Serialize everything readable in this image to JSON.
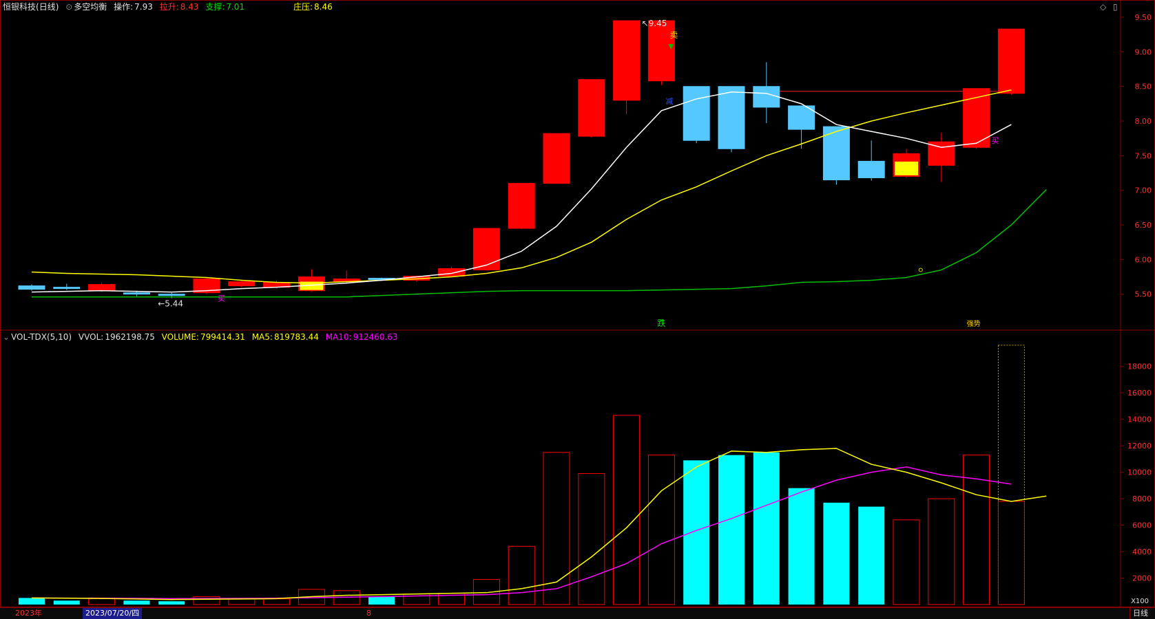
{
  "price_header": {
    "stock": "恒银科技",
    "period": "(日线)",
    "indicator": "多空均衡",
    "op_label": "操作:",
    "op_value": "7.93",
    "lift_label": "拉升:",
    "lift_value": "8.43",
    "support_label": "支撑:",
    "support_value": "7.01",
    "press_label": "庄压:",
    "press_value": "8.46"
  },
  "vol_header": {
    "name": "VOL-TDX(5,10)",
    "vvol_label": "VVOL:",
    "vvol_value": "1962198.75",
    "volume_label": "VOLUME:",
    "volume_value": "799414.31",
    "ma5_label": "MA5:",
    "ma5_value": "819783.44",
    "ma10_label": "MA10:",
    "ma10_value": "912460.63"
  },
  "annotations": {
    "high": "9.45",
    "low": "5.44",
    "sell": "卖",
    "buy": "买",
    "reduce": "减",
    "fall": "跌",
    "strong": "强势"
  },
  "bottom": {
    "year": "2023年",
    "date": "2023/07/20/四",
    "month": "8",
    "period": "日线",
    "vol_unit": "X100"
  },
  "colors": {
    "up": "#ff0000",
    "down": "#54c8ff",
    "vol_down": "#00ffff",
    "ma_white": "#ffffff",
    "ma_yellow": "#ffff00",
    "ma_green": "#00c000",
    "ma10": "#ff00ff"
  },
  "chart_data": [
    {
      "type": "candlestick",
      "y_axis_ticks": [
        "9.50",
        "9.00",
        "8.50",
        "8.00",
        "7.50",
        "7.00",
        "6.50",
        "6.00",
        "5.50"
      ],
      "ylim": [
        5.0,
        9.55
      ],
      "candles": [
        {
          "o": 5.62,
          "c": 5.57,
          "h": 5.64,
          "l": 5.55
        },
        {
          "o": 5.6,
          "c": 5.58,
          "h": 5.65,
          "l": 5.56
        },
        {
          "o": 5.55,
          "c": 5.64,
          "h": 5.66,
          "l": 5.53
        },
        {
          "o": 5.52,
          "c": 5.5,
          "h": 5.55,
          "l": 5.47
        },
        {
          "o": 5.5,
          "c": 5.48,
          "h": 5.52,
          "l": 5.44
        },
        {
          "o": 5.52,
          "c": 5.72,
          "h": 5.74,
          "l": 5.5
        },
        {
          "o": 5.62,
          "c": 5.68,
          "h": 5.7,
          "l": 5.6
        },
        {
          "o": 5.6,
          "c": 5.67,
          "h": 5.7,
          "l": 5.58
        },
        {
          "o": 5.55,
          "c": 5.75,
          "h": 5.86,
          "l": 5.53
        },
        {
          "o": 5.68,
          "c": 5.72,
          "h": 5.84,
          "l": 5.66
        },
        {
          "o": 5.73,
          "c": 5.71,
          "h": 5.74,
          "l": 5.69
        },
        {
          "o": 5.7,
          "c": 5.76,
          "h": 5.77,
          "l": 5.68
        },
        {
          "o": 5.76,
          "c": 5.87,
          "h": 5.9,
          "l": 5.74
        },
        {
          "o": 5.85,
          "c": 6.45,
          "h": 6.45,
          "l": 5.84
        },
        {
          "o": 6.45,
          "c": 7.1,
          "h": 7.1,
          "l": 6.44
        },
        {
          "o": 7.1,
          "c": 7.82,
          "h": 7.82,
          "l": 7.09
        },
        {
          "o": 7.78,
          "c": 8.6,
          "h": 8.6,
          "l": 7.76
        },
        {
          "o": 8.3,
          "c": 9.45,
          "h": 9.45,
          "l": 8.1
        },
        {
          "o": 8.58,
          "c": 9.45,
          "h": 9.45,
          "l": 8.52
        },
        {
          "o": 8.5,
          "c": 7.72,
          "h": 8.5,
          "l": 7.68
        },
        {
          "o": 8.5,
          "c": 7.6,
          "h": 8.5,
          "l": 7.55
        },
        {
          "o": 8.5,
          "c": 8.2,
          "h": 8.85,
          "l": 7.97
        },
        {
          "o": 8.22,
          "c": 7.88,
          "h": 8.22,
          "l": 7.6
        },
        {
          "o": 7.92,
          "c": 7.15,
          "h": 7.92,
          "l": 7.08
        },
        {
          "o": 7.42,
          "c": 7.18,
          "h": 7.72,
          "l": 7.14
        },
        {
          "o": 7.2,
          "c": 7.53,
          "h": 7.6,
          "l": 7.18
        },
        {
          "o": 7.36,
          "c": 7.7,
          "h": 7.83,
          "l": 7.12
        },
        {
          "o": 7.62,
          "c": 8.47,
          "h": 8.47,
          "l": 7.6
        },
        {
          "o": 8.4,
          "c": 9.33,
          "h": 9.33,
          "l": 8.38
        }
      ],
      "ma_white": [
        5.53,
        5.54,
        5.55,
        5.54,
        5.53,
        5.55,
        5.58,
        5.6,
        5.63,
        5.66,
        5.7,
        5.75,
        5.8,
        5.92,
        6.12,
        6.48,
        7.02,
        7.62,
        8.15,
        8.32,
        8.42,
        8.4,
        8.25,
        7.95,
        7.85,
        7.75,
        7.62,
        7.68,
        7.95
      ],
      "ma_yellow": [
        5.82,
        5.8,
        5.79,
        5.78,
        5.76,
        5.74,
        5.7,
        5.67,
        5.66,
        5.68,
        5.7,
        5.72,
        5.75,
        5.8,
        5.88,
        6.03,
        6.25,
        6.58,
        6.86,
        7.05,
        7.28,
        7.5,
        7.67,
        7.85,
        8.0,
        8.12,
        8.23,
        8.34,
        8.45
      ],
      "ma_green": [
        5.46,
        5.46,
        5.46,
        5.46,
        5.46,
        5.46,
        5.46,
        5.46,
        5.46,
        5.46,
        5.48,
        5.5,
        5.52,
        5.54,
        5.55,
        5.55,
        5.55,
        5.55,
        5.56,
        5.57,
        5.58,
        5.62,
        5.67,
        5.68,
        5.7,
        5.74,
        5.85,
        6.1,
        6.5,
        7.01
      ],
      "pressure_line": 8.43
    },
    {
      "type": "bar",
      "y_axis_ticks": [
        "18000",
        "16000",
        "14000",
        "12000",
        "10000",
        "8000",
        "6000",
        "4000",
        "2000"
      ],
      "ylim": [
        0,
        19700
      ],
      "volumes": [
        500,
        300,
        450,
        300,
        250,
        600,
        420,
        430,
        1150,
        1050,
        620,
        800,
        850,
        1900,
        4400,
        11500,
        9900,
        14300,
        11300,
        10900,
        11300,
        11500,
        8800,
        7700,
        7400,
        6400,
        8000,
        11300,
        19600
      ],
      "ma5": [
        500,
        480,
        460,
        420,
        380,
        400,
        420,
        450,
        600,
        700,
        750,
        800,
        850,
        900,
        1200,
        1700,
        3600,
        5800,
        8600,
        10400,
        11600,
        11500,
        11700,
        11800,
        10600,
        10000,
        9200,
        8300,
        7800,
        8200
      ],
      "ma10": [
        500,
        490,
        480,
        470,
        450,
        460,
        470,
        480,
        520,
        560,
        600,
        650,
        700,
        750,
        900,
        1200,
        2100,
        3100,
        4600,
        5600,
        6500,
        7500,
        8500,
        9400,
        10000,
        10400,
        9800,
        9500,
        9100
      ]
    }
  ]
}
